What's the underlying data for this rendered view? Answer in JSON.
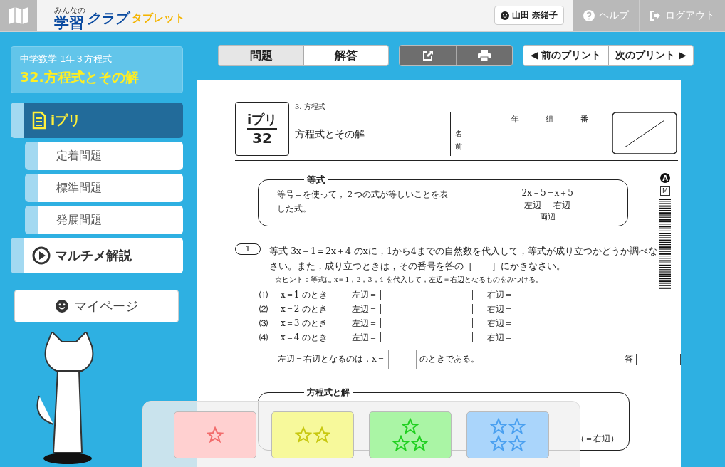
{
  "header": {
    "logo_small": "みんなの",
    "logo_main": "学習",
    "logo_sub": "クラブ",
    "logo_tablet": "タブレット",
    "user": "山田 奈緒子",
    "help": "ヘルプ",
    "logout": "ログアウト"
  },
  "lesson": {
    "path": "中学数学 1年３方程式",
    "title": "32.方程式とその解"
  },
  "sidebar": [
    {
      "label": "iプリ",
      "kind": "doc",
      "selected": true,
      "children": [
        {
          "label": "定着問題",
          "selected": false
        },
        {
          "label": "標準問題",
          "selected": false
        },
        {
          "label": "発展問題",
          "selected": false
        }
      ]
    },
    {
      "label": "マルチメ解説",
      "kind": "play",
      "selected": false
    }
  ],
  "mypage": "マイページ",
  "view_tabs": [
    {
      "label": "問題",
      "selected": true
    },
    {
      "label": "解答",
      "selected": false
    }
  ],
  "nav": [
    "◀ 前のプリント",
    "次のプリント ▶"
  ],
  "worksheet": {
    "unit": "3.  方程式",
    "badge_top": "iプリ",
    "badge_num": "32",
    "title": "方程式とその解",
    "grade": [
      "年",
      "組",
      "番"
    ],
    "name": [
      "名",
      "前"
    ],
    "side_marks": [
      "A",
      "M"
    ],
    "definition": {
      "heading": "等式",
      "text": "等号＝を使って，２つの式が等しいことを表した式。",
      "example": "2x－5＝x＋5",
      "left": "左辺",
      "right": "右辺",
      "both": "両辺"
    },
    "problem": {
      "number": "1",
      "text": "等式 3x＋1＝2x＋4 のxに，1から4までの自然数を代入して，等式が成り立つかどうか調べなさい。また，成り立つときは，その番号を答の［　　］にかきなさい。",
      "hint": "☆ヒント：等式に x＝1，2，3，4 を代入して，左辺＝右辺となるものをみつける。",
      "rows": [
        {
          "num": "⑴",
          "cond": "x＝1 のとき",
          "left": "左辺＝",
          "right": "右辺＝"
        },
        {
          "num": "⑵",
          "cond": "x＝2 のとき",
          "left": "左辺＝",
          "right": "右辺＝"
        },
        {
          "num": "⑶",
          "cond": "x＝3 のとき",
          "left": "左辺＝",
          "right": "右辺＝"
        },
        {
          "num": "⑷",
          "cond": "x＝4 のとき",
          "left": "左辺＝",
          "right": "右辺＝"
        }
      ],
      "conclusion_before": "左辺＝右辺となるのは，x＝",
      "conclusion_after": "のときである。",
      "answer_label": "答"
    },
    "next_section": {
      "heading": "方程式と解",
      "tail": "（＝右辺）"
    }
  },
  "ratings": [
    {
      "kind": "single",
      "color": "#ffd0d0"
    },
    {
      "kind": "double",
      "color": "#f7f99b"
    },
    {
      "kind": "triple",
      "color": "#aaf5a5"
    },
    {
      "kind": "quadruple",
      "color": "#aad5fb"
    }
  ]
}
